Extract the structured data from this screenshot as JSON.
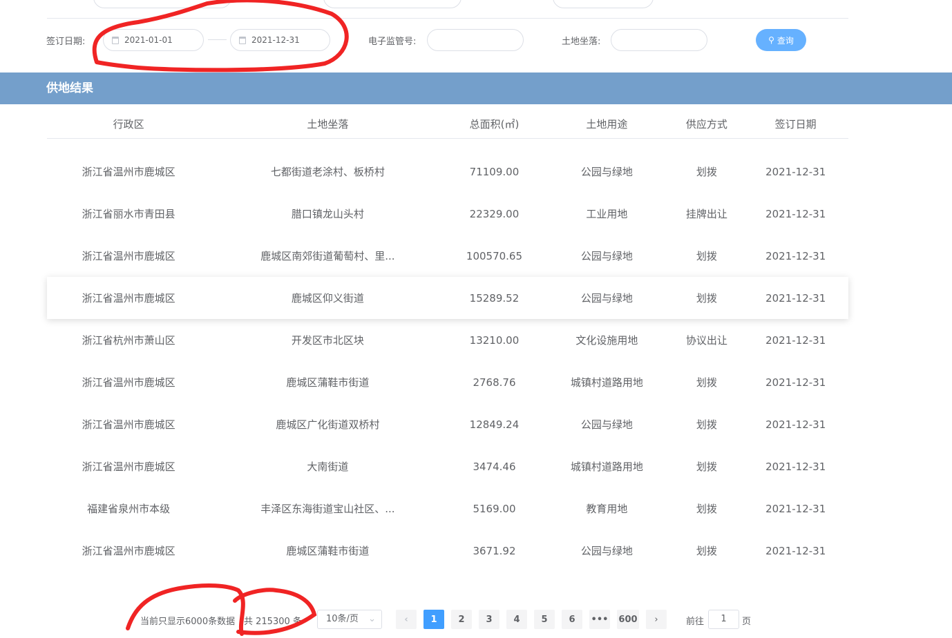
{
  "filters": {
    "date_label": "签订日期:",
    "date_start": "2021-01-01",
    "date_end": "2021-12-31",
    "supervision_label": "电子监管号:",
    "supervision_value": "",
    "location_label": "土地坐落:",
    "location_value": "",
    "search_label": "查询"
  },
  "banner": "供地结果",
  "table": {
    "headers": [
      "行政区",
      "土地坐落",
      "总面积(㎡)",
      "土地用途",
      "供应方式",
      "签订日期"
    ],
    "rows": [
      [
        "浙江省温州市鹿城区",
        "七都街道老涂村、板桥村",
        "71109.00",
        "公园与绿地",
        "划拨",
        "2021-12-31"
      ],
      [
        "浙江省丽水市青田县",
        "腊口镇龙山头村",
        "22329.00",
        "工业用地",
        "挂牌出让",
        "2021-12-31"
      ],
      [
        "浙江省温州市鹿城区",
        "鹿城区南郊街道葡萄村、里...",
        "100570.65",
        "公园与绿地",
        "划拨",
        "2021-12-31"
      ],
      [
        "浙江省温州市鹿城区",
        "鹿城区仰义街道",
        "15289.52",
        "公园与绿地",
        "划拨",
        "2021-12-31"
      ],
      [
        "浙江省杭州市萧山区",
        "开发区市北区块",
        "13210.00",
        "文化设施用地",
        "协议出让",
        "2021-12-31"
      ],
      [
        "浙江省温州市鹿城区",
        "鹿城区蒲鞋市街道",
        "2768.76",
        "城镇村道路用地",
        "划拨",
        "2021-12-31"
      ],
      [
        "浙江省温州市鹿城区",
        "鹿城区广化街道双桥村",
        "12849.24",
        "公园与绿地",
        "划拨",
        "2021-12-31"
      ],
      [
        "浙江省温州市鹿城区",
        "大南街道",
        "3474.46",
        "城镇村道路用地",
        "划拨",
        "2021-12-31"
      ],
      [
        "福建省泉州市本级",
        "丰泽区东海街道宝山社区、...",
        "5169.00",
        "教育用地",
        "划拨",
        "2021-12-31"
      ],
      [
        "浙江省温州市鹿城区",
        "鹿城区蒲鞋市街道",
        "3671.92",
        "公园与绿地",
        "划拨",
        "2021-12-31"
      ]
    ]
  },
  "pagination": {
    "notice": "当前只显示6000条数据",
    "total": "共 215300 条",
    "page_size": "10条/页",
    "pages": [
      "1",
      "2",
      "3",
      "4",
      "5",
      "6",
      "•••",
      "600"
    ],
    "goto_label": "前往",
    "goto_value": "1",
    "goto_suffix": "页"
  }
}
